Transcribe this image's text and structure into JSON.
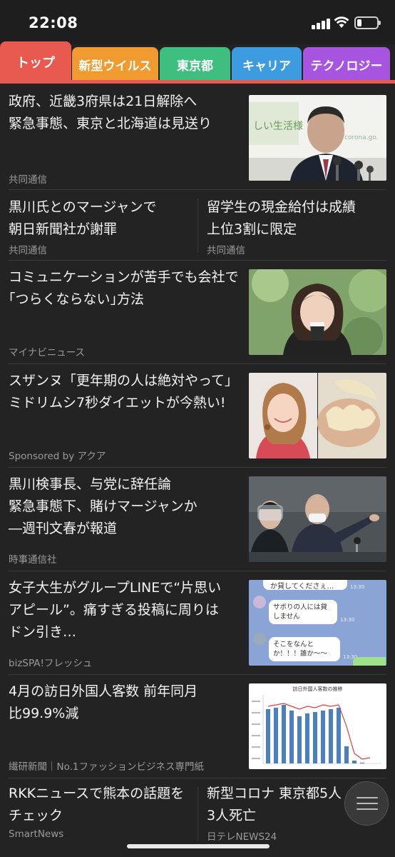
{
  "status": {
    "time": "22:08"
  },
  "tabs": [
    {
      "label": "トップ",
      "color": "#e85a4f"
    },
    {
      "label": "新型ウイルス",
      "color": "#f19a2f"
    },
    {
      "label": "東京都",
      "color": "#3fbf7f"
    },
    {
      "label": "キャリア",
      "color": "#3d9be0"
    },
    {
      "label": "テクノロジー",
      "color": "#a755e0"
    }
  ],
  "articles": {
    "a1": {
      "title_l1": "政府、近畿3府県は21日解除へ",
      "title_l2": "緊急事態、東京と北海道は見送り",
      "source": "共同通信"
    },
    "a2": {
      "title_l1": "黒川氏とのマージャンで",
      "title_l2": "朝日新聞社が謝罪",
      "source": "共同通信"
    },
    "a3": {
      "title_l1": "留学生の現金給付は成績",
      "title_l2": "上位3割に限定",
      "source": "共同通信"
    },
    "a4": {
      "title_l1": "コミュニケーションが苦手でも会社で",
      "title_l2": "｢つらくならない｣方法",
      "source": "マイナビニュース"
    },
    "a5": {
      "title_l1": "スザンヌ「更年期の人は絶対やって」",
      "title_l2": "ミドリムシ7秒ダイエットが今熱い!",
      "source": "Sponsored by アクア"
    },
    "a6": {
      "title_l1": "黒川検事長、与党に辞任論",
      "title_l2": "緊急事態下、賭けマージャンか",
      "title_l3": "―週刊文春が報道",
      "source": "時事通信社"
    },
    "a7": {
      "title_l1": "女子大生がグループLINEで“片思い",
      "title_l2": "アピール”。痛すぎる投稿に周りは",
      "title_l3": "ドン引き…",
      "source": "bizSPA!フレッシュ"
    },
    "a8": {
      "title_l1": "4月の訪日外国人客数 前年同月",
      "title_l2": "比99.9%減",
      "source": "繊研新聞｜No.1ファッションビジネス専門紙"
    },
    "a9": {
      "title_l1": "RKKニュースで熊本の話題を",
      "title_l2": "チェック",
      "source": "SmartNews"
    },
    "a10": {
      "title_l1": "新型コロナ 東京都5人",
      "title_l2": "3人死亡",
      "source": "日テレNEWS24"
    }
  },
  "chat_thumb": {
    "msg1": "か貸してくださぇ…",
    "msg2": "サボりの人には貸しません",
    "msg3": "そこをなんとか！！！誰か〜〜",
    "time": "13:30"
  },
  "graph_thumb": {
    "title": "訪日外国人客数の推移"
  },
  "icons": {
    "menu": "hamburger-menu-icon",
    "signal": "cellular-signal-icon",
    "wifi": "wifi-icon",
    "battery": "battery-icon"
  }
}
